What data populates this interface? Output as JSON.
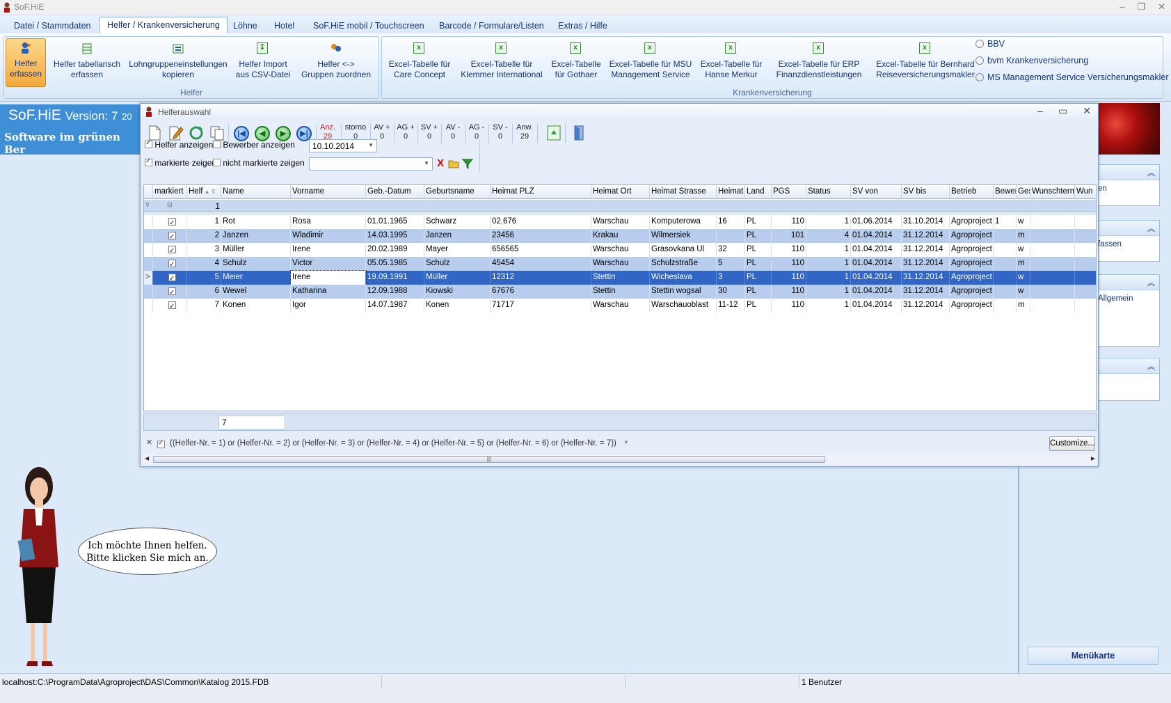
{
  "window": {
    "title": "SoF.HiE"
  },
  "menu": {
    "tabs": [
      "Datei / Stammdaten",
      "Helfer / Krankenversicherung",
      "Löhne",
      "Hotel",
      "SoF.HiE mobil / Touchscreen",
      "Barcode / Formulare/Listen",
      "Extras / Hilfe"
    ],
    "active": "Helfer / Krankenversicherung"
  },
  "ribbon": {
    "helfer_group": {
      "title": "Helfer",
      "buttons": [
        {
          "l1": "Helfer",
          "l2": "erfassen"
        },
        {
          "l1": "Helfer tabellarisch",
          "l2": "erfassen"
        },
        {
          "l1": "Lohngruppeneinstellungen",
          "l2": "kopieren"
        },
        {
          "l1": "Helfer Import",
          "l2": "aus CSV-Datei"
        },
        {
          "l1": "Helfer <->",
          "l2": "Gruppen zuordnen"
        }
      ]
    },
    "kv_group": {
      "title": "Krankenversicherung",
      "buttons": [
        {
          "l1": "Excel-Tabelle für",
          "l2": "Care Concept"
        },
        {
          "l1": "Excel-Tabelle für",
          "l2": "Klemmer International"
        },
        {
          "l1": "Excel-Tabelle",
          "l2": "für Gothaer"
        },
        {
          "l1": "Excel-Tabelle für MSU",
          "l2": "Management Service"
        },
        {
          "l1": "Excel-Tabelle für",
          "l2": "Hanse Merkur"
        },
        {
          "l1": "Excel-Tabelle für ERP",
          "l2": "Finanzdienstleistungen"
        },
        {
          "l1": "Excel-Tabelle für Bernhard",
          "l2": "Reiseversicherungsmakler"
        }
      ],
      "small": [
        "BBV",
        "bvm Krankenversicherung",
        "MS Management Service Versicherungsmakler"
      ]
    }
  },
  "banner": {
    "title": "SoF.HiE",
    "version_label": "Version: 7",
    "version_cut": "20",
    "subtitle": "Software im grünen Ber"
  },
  "right_panel": {
    "p2": "fassen",
    "p1": "en",
    "p3": "Allgemein",
    "menukarte": "Menükarte"
  },
  "assistant": {
    "line1": "Ich möchte Ihnen helfen.",
    "line2": "Bitte klicken Sie mich an."
  },
  "status": {
    "path": "localhost:C:\\ProgramData\\Agroproject\\DAS\\Common\\Katalog 2015.FDB",
    "users": "1 Benutzer"
  },
  "dialog": {
    "title": "Helferauswahl",
    "counters": [
      {
        "label": "Anz.",
        "value": "29"
      },
      {
        "label": "storno",
        "value": "0"
      },
      {
        "label": "AV +",
        "value": "0"
      },
      {
        "label": "AG +",
        "value": "0"
      },
      {
        "label": "SV +",
        "value": "0"
      },
      {
        "label": "AV -",
        "value": "0"
      },
      {
        "label": "AG -",
        "value": "0"
      },
      {
        "label": "SV -",
        "value": "0"
      },
      {
        "label": "Anw.",
        "value": "29"
      }
    ],
    "filters": {
      "show_helfer": "Helfer anzeigen",
      "show_bewerber": "Bewerber anzeigen",
      "date": "10.10.2014",
      "show_marked": "markierte zeigen",
      "show_unmarked": "nicht markierte zeigen",
      "search_value": ""
    },
    "columns": [
      "markiert",
      "Helf",
      "Name",
      "Vorname",
      "Geb.-Datum",
      "Geburtsname",
      "Heimat PLZ",
      "Heimat Ort",
      "Heimat Strasse",
      "Heimat I",
      "Land",
      "PGS",
      "Status",
      "SV von",
      "SV bis",
      "Betrieb",
      "Bewer",
      "Ges",
      "Wunschterm",
      "Wun"
    ],
    "filter_row_value": "1",
    "rows": [
      {
        "nr": "1",
        "name": "Rot",
        "vorname": "Rosa",
        "geb": "01.01.1965",
        "gebname": "Schwarz",
        "plz": "02.676",
        "ort": "Warschau",
        "str": "Komputerowa",
        "hnr": "16",
        "land": "PL",
        "pgs": "110",
        "status": "1",
        "svvon": "01.06.2014",
        "svbis": "31.10.2014",
        "betrieb": "Agroproject",
        "bewer": "1",
        "ges": "w"
      },
      {
        "nr": "2",
        "name": "Janzen",
        "vorname": "Wladimir",
        "geb": "14.03.1995",
        "gebname": "Janzen",
        "plz": "23456",
        "ort": "Krakau",
        "str": "Wilmersiek",
        "hnr": "",
        "land": "PL",
        "pgs": "101",
        "status": "4",
        "svvon": "01.04.2014",
        "svbis": "31.12.2014",
        "betrieb": "Agroproject",
        "bewer": "",
        "ges": "m"
      },
      {
        "nr": "3",
        "name": "Müller",
        "vorname": "Irene",
        "geb": "20.02.1989",
        "gebname": "Mayer",
        "plz": "656565",
        "ort": "Warschau",
        "str": "Grasovkana Ul",
        "hnr": "32",
        "land": "PL",
        "pgs": "110",
        "status": "1",
        "svvon": "01.04.2014",
        "svbis": "31.12.2014",
        "betrieb": "Agroproject",
        "bewer": "",
        "ges": "w"
      },
      {
        "nr": "4",
        "name": "Schulz",
        "vorname": "Victor",
        "geb": "05.05.1985",
        "gebname": "Schulz",
        "plz": "45454",
        "ort": "Warschau",
        "str": "Schulzstraße",
        "hnr": "5",
        "land": "PL",
        "pgs": "110",
        "status": "1",
        "svvon": "01.04.2014",
        "svbis": "31.12.2014",
        "betrieb": "Agroproject",
        "bewer": "",
        "ges": "m"
      },
      {
        "nr": "5",
        "name": "Meier",
        "vorname": "Irene",
        "geb": "19.09.1991",
        "gebname": "Müller",
        "plz": "12312",
        "ort": "Stettin",
        "str": "Wicheslava",
        "hnr": "3",
        "land": "PL",
        "pgs": "110",
        "status": "1",
        "svvon": "01.04.2014",
        "svbis": "31.12.2014",
        "betrieb": "Agroproject",
        "bewer": "",
        "ges": "w"
      },
      {
        "nr": "6",
        "name": "Wewel",
        "vorname": "Katharina",
        "geb": "12.09.1988",
        "gebname": "Kiowski",
        "plz": "67676",
        "ort": "Stettin",
        "str": "Stettin wogsal",
        "hnr": "30",
        "land": "PL",
        "pgs": "110",
        "status": "1",
        "svvon": "01.04.2014",
        "svbis": "31.12.2014",
        "betrieb": "Agroproject",
        "bewer": "",
        "ges": "w"
      },
      {
        "nr": "7",
        "name": "Konen",
        "vorname": "Igor",
        "geb": "14.07.1987",
        "gebname": "Konen",
        "plz": "71717",
        "ort": "Warschau",
        "str": "Warschauoblast",
        "hnr": "11-12",
        "land": "PL",
        "pgs": "110",
        "status": "1",
        "svvon": "01.04.2014",
        "svbis": "31.12.2014",
        "betrieb": "Agroproject",
        "bewer": "",
        "ges": "m"
      }
    ],
    "selected_row": 4,
    "row_count": "7",
    "filter_expression": "((Helfer-Nr. = 1) or (Helfer-Nr. = 2) or (Helfer-Nr. = 3) or (Helfer-Nr. = 4) or (Helfer-Nr. = 5) or (Helfer-Nr. = 6) or (Helfer-Nr. = 7))",
    "customize": "Customize..."
  }
}
